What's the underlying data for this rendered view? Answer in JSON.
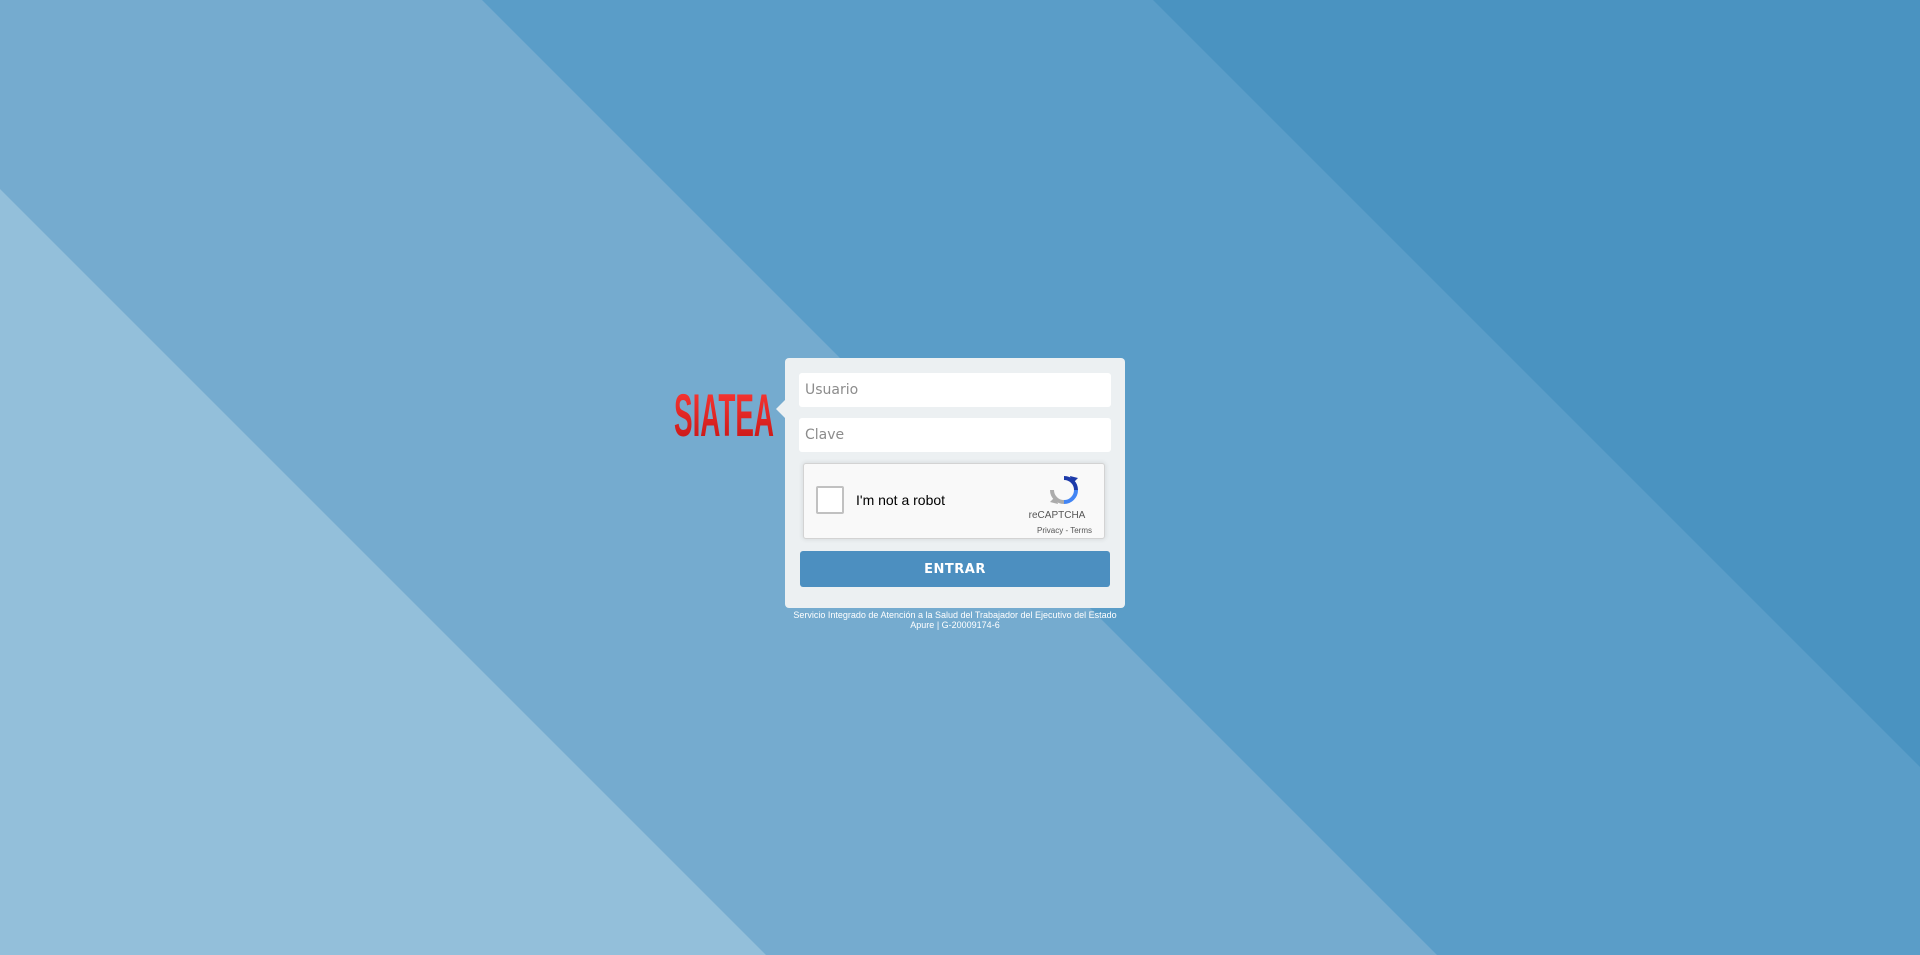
{
  "background": {
    "colors": [
      "#93bfda",
      "#75abcf",
      "#5a9dc8",
      "#4a93c1"
    ]
  },
  "logo": {
    "text": "SIATEA",
    "color": "#e0201e"
  },
  "login": {
    "username_placeholder": "Usuario",
    "username_value": "",
    "password_placeholder": "Clave",
    "password_value": "",
    "submit_label": "ENTRAR",
    "accent": "#4c8fc0"
  },
  "captcha": {
    "label": "I'm not a robot",
    "brand": "reCAPTCHA",
    "privacy": "Privacy",
    "separator": " - ",
    "terms": "Terms",
    "icon": "recaptcha-icon"
  },
  "footer": {
    "text": "Servicio Integrado de Atención a la Salud del Trabajador del Ejecutivo del Estado Apure | G-20009174-6"
  }
}
